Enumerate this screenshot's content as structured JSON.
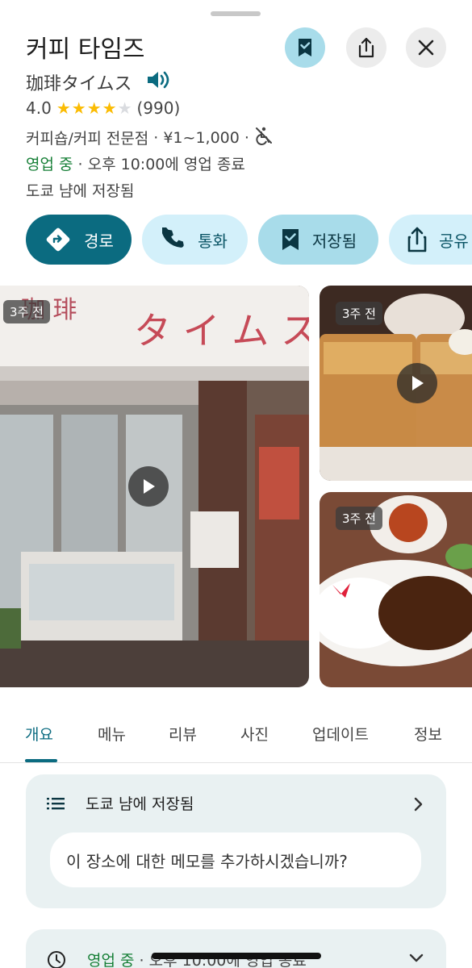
{
  "place": {
    "name": "커피 타임즈",
    "name_local": "珈琲タイムス",
    "rating": "4.0",
    "rating_value": 4.0,
    "review_count": "(990)",
    "category": "커피숍/커피 전문점",
    "separator": "·",
    "price": "¥1~1,000",
    "open_status": "영업 중",
    "close_info": "· 오후 10:00에 영업 종료",
    "saved_in": "도쿄 냠에 저장됨"
  },
  "actions": [
    {
      "label": "경로",
      "icon": "directions-icon"
    },
    {
      "label": "통화",
      "icon": "phone-icon"
    },
    {
      "label": "저장됨",
      "icon": "bookmark-icon"
    },
    {
      "label": "공유",
      "icon": "share-icon"
    }
  ],
  "photos": [
    {
      "badge": "3주 전",
      "type": "video",
      "subject": "storefront"
    },
    {
      "badge": "3주 전",
      "type": "video",
      "subject": "toast"
    },
    {
      "badge": "3주 전",
      "type": "photo",
      "subject": "curry"
    }
  ],
  "tabs": [
    "개요",
    "메뉴",
    "리뷰",
    "사진",
    "업데이트",
    "정보"
  ],
  "active_tab": "개요",
  "notes_card": {
    "title": "도쿄 냠에 저장됨",
    "memo_placeholder": "이 장소에 대한 메모를 추가하시겠습니까?"
  },
  "hours_card": {
    "open_status": "영업 중",
    "close_info": "· 오후 10:00에 영업 종료"
  },
  "colors": {
    "accent": "#0b6b80",
    "open_green": "#188038",
    "star": "#fbbc04",
    "chip_light": "#d3f0fa",
    "chip_saved": "#a8dcea"
  }
}
